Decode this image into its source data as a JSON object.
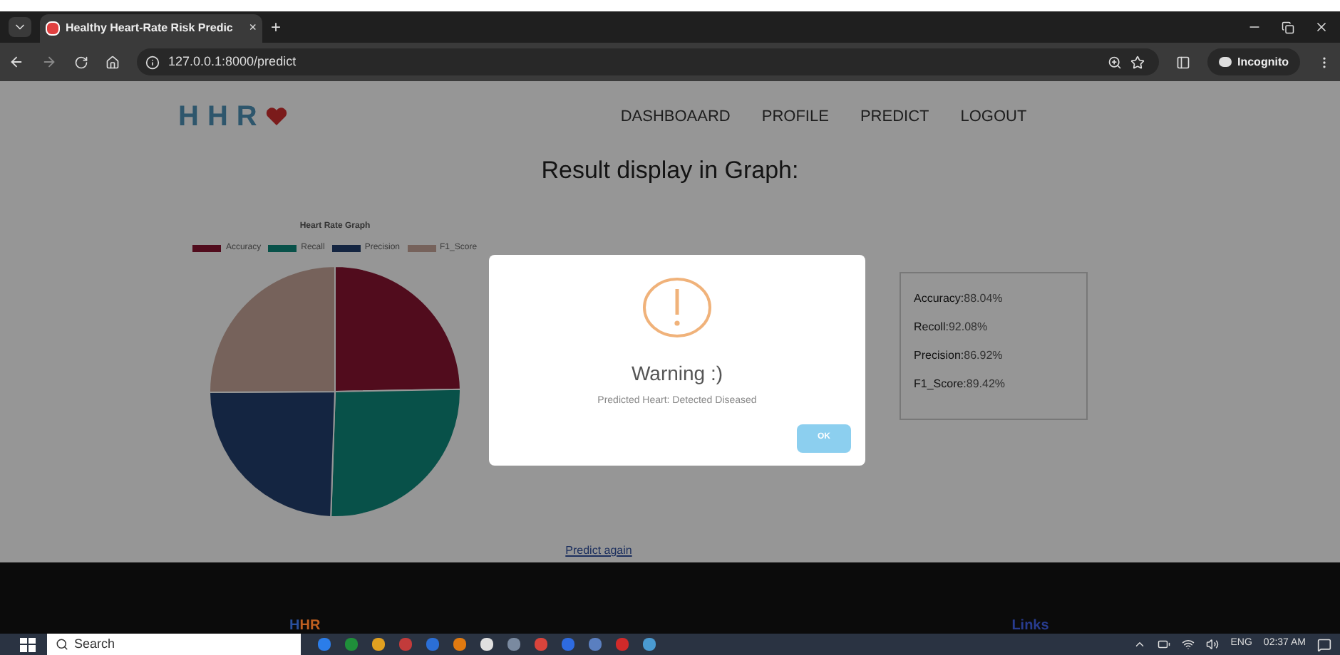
{
  "browser": {
    "tab_title": "Healthy Heart-Rate Risk Predic",
    "tab_close": "×",
    "new_tab": "+",
    "url": "127.0.0.1:8000/predict",
    "incognito": "Incognito"
  },
  "navbar": {
    "logo": "HHR",
    "links": [
      {
        "label": "DASHBOAARD"
      },
      {
        "label": "PROFILE"
      },
      {
        "label": "PREDICT"
      },
      {
        "label": "LOGOUT"
      }
    ]
  },
  "heading": "Result display in Graph:",
  "chart": {
    "chart_data": {
      "type": "pie",
      "title": "Heart Rate Graph",
      "categories": [
        "Accuracy",
        "Recall",
        "Precision",
        "F1_Score"
      ],
      "series": [
        {
          "values": [
            24.7,
            25.83,
            24.38,
            25.09
          ]
        }
      ],
      "colors": [
        "#8a1632",
        "#0f8a7c",
        "#23406f",
        "#c9a79b"
      ]
    }
  },
  "metrics": [
    {
      "label": "Accuracy:",
      "value": "88.04%"
    },
    {
      "label": "Recoll:",
      "value": "92.08%"
    },
    {
      "label": "Precision:",
      "value": "86.92%"
    },
    {
      "label": "F1_Score:",
      "value": "89.42%"
    }
  ],
  "predict_again": "Predict again",
  "dialog": {
    "title": "Warning :)",
    "message": "Predicted Heart: Detected Diseased",
    "button": "OK"
  },
  "footer": {
    "brand_first": "H",
    "brand_rest": "HR",
    "links_heading": "Links"
  },
  "taskbar": {
    "search": "Search",
    "language": "ENG",
    "time": "02:37 AM"
  }
}
